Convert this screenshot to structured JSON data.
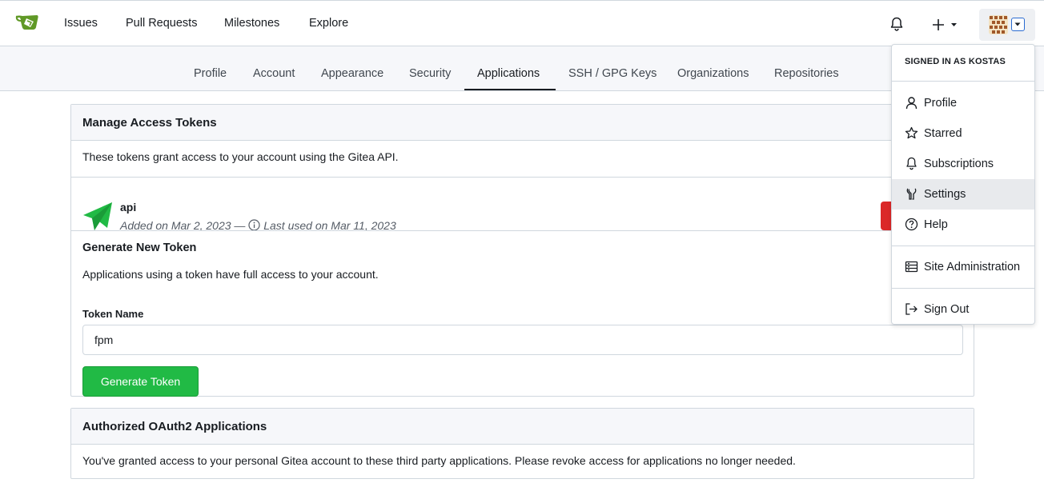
{
  "navbar": {
    "items": [
      "Issues",
      "Pull Requests",
      "Milestones",
      "Explore"
    ],
    "icons": {
      "logo": "gitea-logo",
      "notifications": "bell-icon",
      "create": "plus-icon",
      "caret": "chevron-down-icon"
    },
    "brand_color": "#609926"
  },
  "tabs": {
    "items": [
      "Profile",
      "Account",
      "Appearance",
      "Security",
      "Applications",
      "SSH / GPG Keys",
      "Organizations",
      "Repositories"
    ],
    "active": "Applications"
  },
  "tokens_section": {
    "title": "Manage Access Tokens",
    "description": "These tokens grant access to your account using the Gitea API.",
    "token": {
      "name": "api",
      "added": "Added on Mar 2, 2023 —",
      "last_used": "Last used on Mar 11, 2023",
      "icon_color": "#21ba45"
    },
    "generate": {
      "title": "Generate New Token",
      "note": "Applications using a token have full access to your account.",
      "field_label": "Token Name",
      "field_value": "fpm",
      "button_label": "Generate Token"
    }
  },
  "oauth_section": {
    "title": "Authorized OAuth2 Applications",
    "description": "You've granted access to your personal Gitea account to these third party applications. Please revoke access for applications no longer needed."
  },
  "user_menu": {
    "header": "SIGNED IN AS KOSTAS",
    "items": [
      "Profile",
      "Starred",
      "Subscriptions",
      "Settings",
      "Help"
    ],
    "admin": "Site Administration",
    "signout": "Sign Out",
    "highlighted": "Settings"
  },
  "colors": {
    "danger": "#db2828",
    "primary_button": "#21ba45",
    "focus_border": "#2a6bd1"
  }
}
